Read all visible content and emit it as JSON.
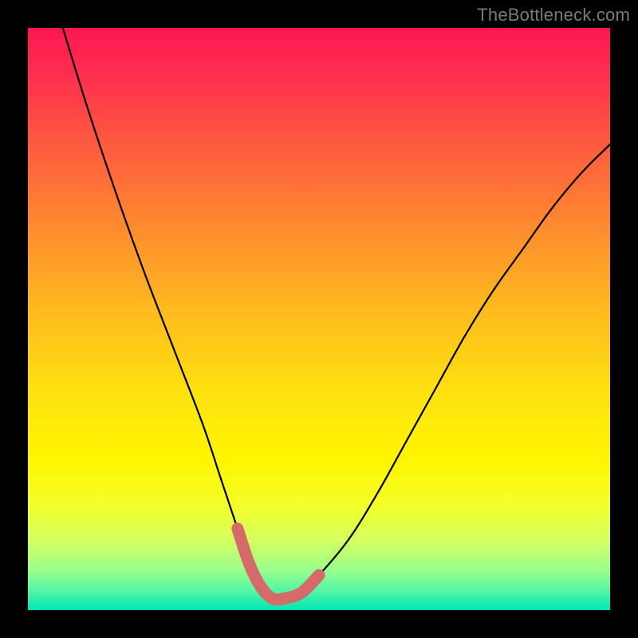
{
  "watermark": "TheBottleneck.com",
  "chart_data": {
    "type": "line",
    "title": "",
    "xlabel": "",
    "ylabel": "",
    "xlim": [
      0,
      100
    ],
    "ylim": [
      0,
      100
    ],
    "series": [
      {
        "name": "curve",
        "x": [
          6,
          10,
          15,
          20,
          25,
          30,
          33,
          36,
          38,
          40,
          42,
          44,
          47,
          50,
          55,
          60,
          65,
          70,
          75,
          80,
          85,
          90,
          95,
          100
        ],
        "values": [
          100,
          87,
          72,
          58,
          45,
          32,
          23,
          14,
          8,
          4,
          2,
          2,
          3,
          6,
          12,
          20,
          29,
          38,
          47,
          55,
          62,
          69,
          75,
          80
        ]
      },
      {
        "name": "highlight",
        "x": [
          36,
          38,
          40,
          42,
          44,
          47,
          50
        ],
        "values": [
          14,
          8,
          4,
          2,
          2,
          3,
          6
        ]
      }
    ],
    "highlight_color": "#d46a6a",
    "curve_color": "#000000"
  }
}
